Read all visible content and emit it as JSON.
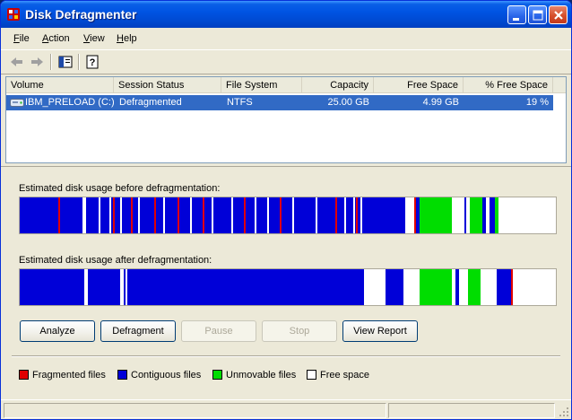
{
  "window": {
    "title": "Disk Defragmenter",
    "app_icon": "defrag-app-icon",
    "controls": [
      "minimize-icon",
      "maximize-icon",
      "close-icon"
    ]
  },
  "menu": {
    "items": [
      "File",
      "Action",
      "View",
      "Help"
    ]
  },
  "toolbar": {
    "icons": [
      "back-arrow-icon",
      "forward-arrow-icon",
      "show-hide-console-tree-icon",
      "help-icon"
    ]
  },
  "volumes": {
    "columns": [
      "Volume",
      "Session Status",
      "File System",
      "Capacity",
      "Free Space",
      "% Free Space"
    ],
    "rows": [
      {
        "volume": "IBM_PRELOAD (C:)",
        "session_status": "Defragmented",
        "file_system": "NTFS",
        "capacity": "25.00 GB",
        "free_space": "4.99 GB",
        "percent_free": "19 %"
      }
    ]
  },
  "analysis": {
    "before_label": "Estimated disk usage before defragmentation:",
    "after_label": "Estimated disk usage after defragmentation:"
  },
  "buttons": {
    "analyze": "Analyze",
    "defragment": "Defragment",
    "pause": "Pause",
    "stop": "Stop",
    "view_report": "View Report"
  },
  "legend": {
    "fragmented": "Fragmented files",
    "contiguous": "Contiguous files",
    "unmovable": "Unmovable files",
    "free": "Free space"
  },
  "colors": {
    "fragmented": "#e00000",
    "contiguous": "#0000d8",
    "unmovable": "#00dd00",
    "free": "#ffffff",
    "selection": "#316ac5",
    "titlebar": "#0054e3"
  }
}
